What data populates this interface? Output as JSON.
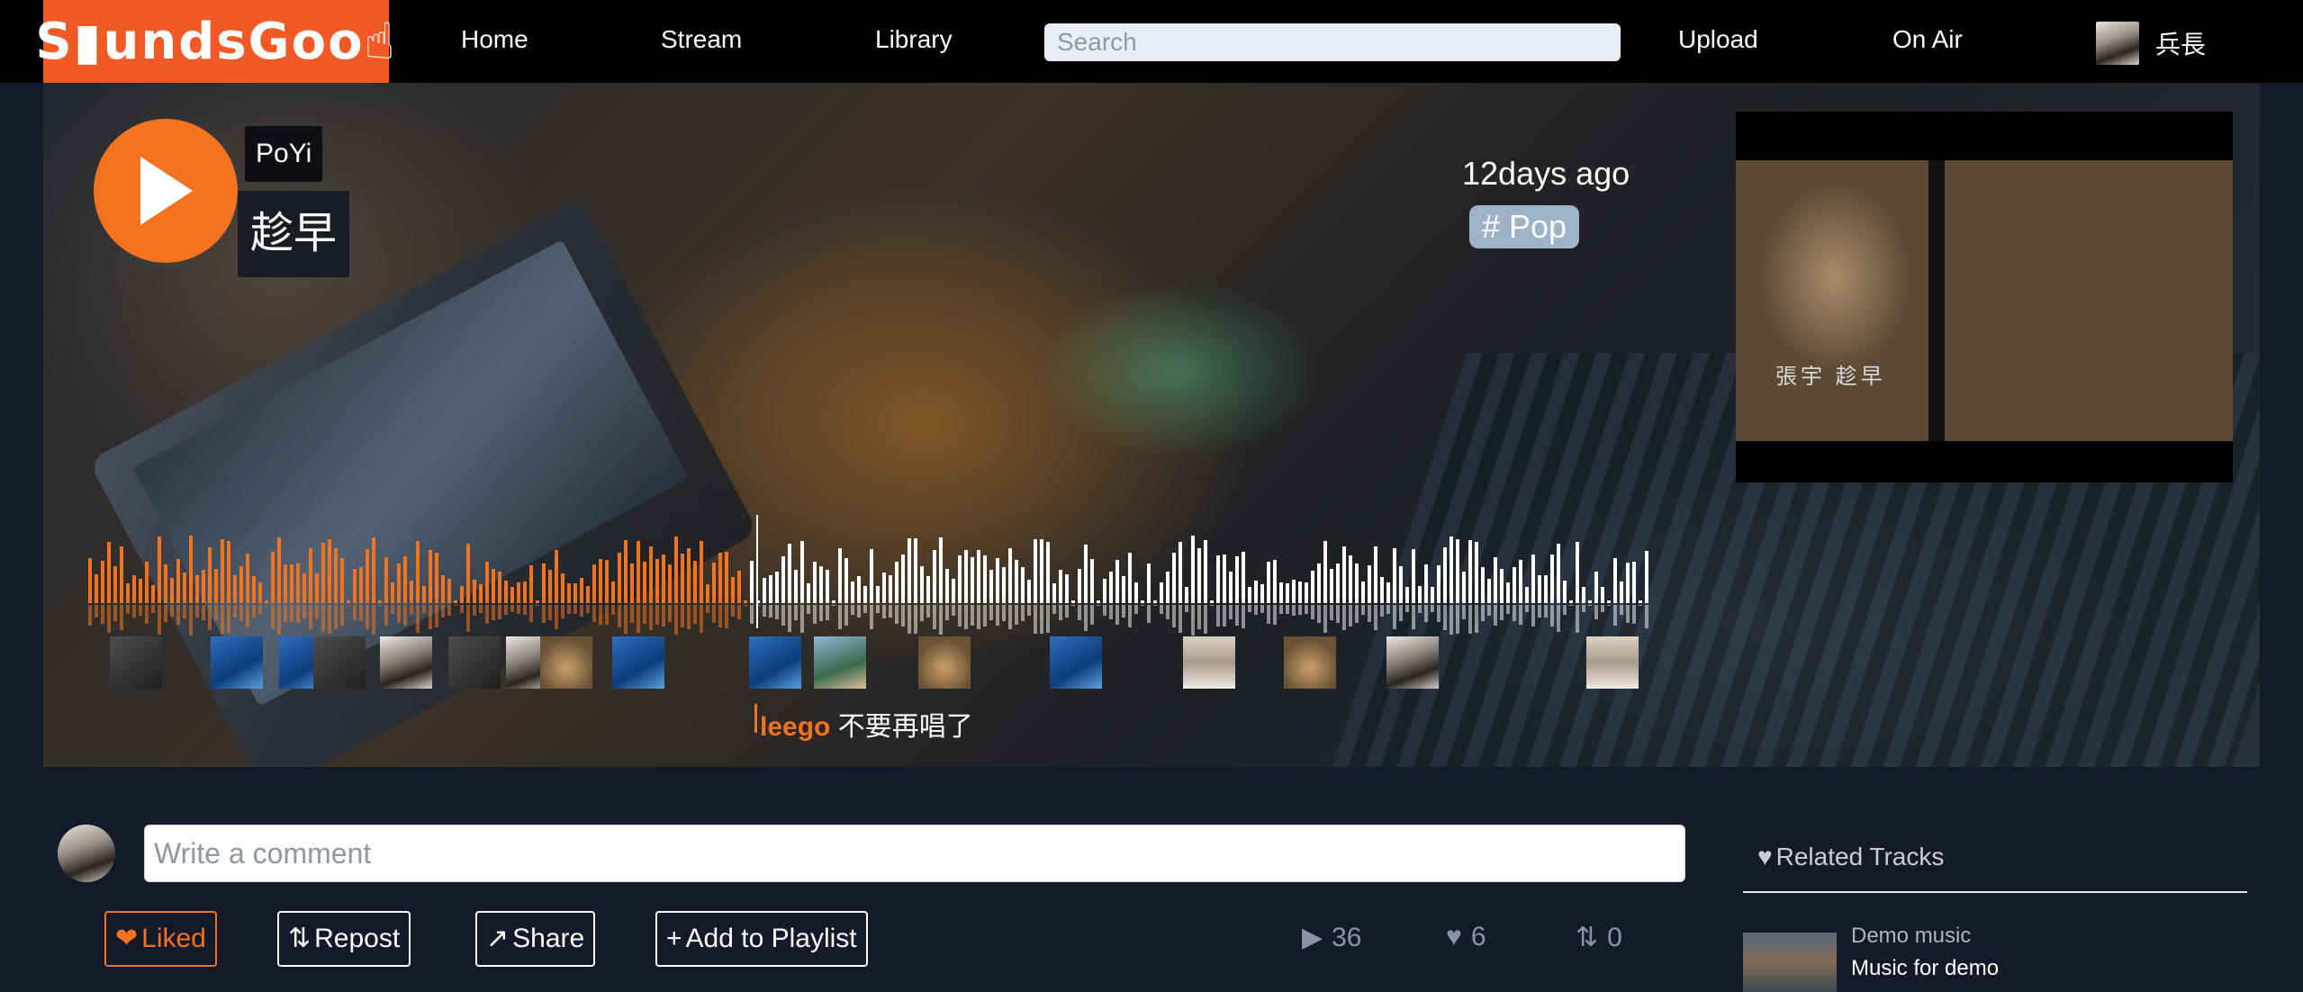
{
  "nav": {
    "logo": "S▮undsGoo☝",
    "links": [
      "Home",
      "Stream",
      "Library",
      "Upload",
      "On Air"
    ],
    "search_placeholder": "Search",
    "user_name": "兵長"
  },
  "track": {
    "artist": "PoYi",
    "title": "趁早",
    "time_ago": "12days ago",
    "genre": "# Pop",
    "cover_text": "張宇 趁早"
  },
  "comment_popup": {
    "user": "leego",
    "text": "不要再唱了"
  },
  "comment": {
    "placeholder": "Write a comment"
  },
  "actions": {
    "liked": "Liked",
    "repost": "Repost",
    "share": "Share",
    "add_playlist": "Add to Playlist"
  },
  "stats": {
    "plays": "36",
    "likes": "6",
    "reposts": "0"
  },
  "related": {
    "title": "Related Tracks",
    "items": [
      {
        "user": "Demo music",
        "name": "Music for demo"
      }
    ]
  },
  "colors": {
    "accent": "#f47321",
    "background": "#141a29"
  },
  "waveform": {
    "progress": 0.42
  }
}
